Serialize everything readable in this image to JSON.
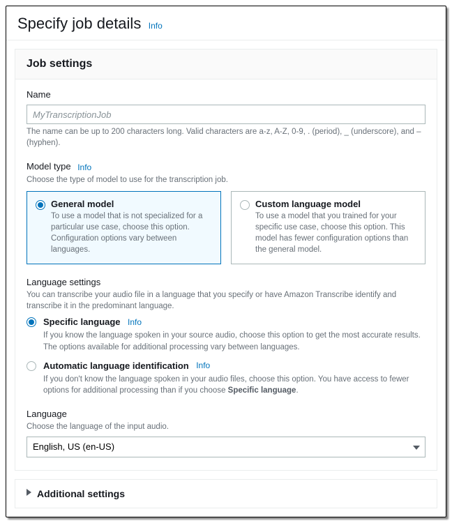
{
  "page": {
    "title": "Specify job details",
    "info": "Info"
  },
  "jobSettings": {
    "heading": "Job settings",
    "name": {
      "label": "Name",
      "placeholder": "MyTranscriptionJob",
      "hint": "The name can be up to 200 characters long. Valid characters are a-z, A-Z, 0-9, . (period), _ (underscore), and – (hyphen)."
    },
    "modelType": {
      "label": "Model type",
      "info": "Info",
      "hint": "Choose the type of model to use for the transcription job.",
      "options": [
        {
          "title": "General model",
          "desc": "To use a model that is not specialized for a particular use case, choose this option. Configuration options vary between languages.",
          "selected": true
        },
        {
          "title": "Custom language model",
          "desc": "To use a model that you trained for your specific use case, choose this option. This model has fewer configuration options than the general model.",
          "selected": false
        }
      ]
    },
    "languageSettings": {
      "label": "Language settings",
      "hint": "You can transcribe your audio file in a language that you specify or have Amazon Transcribe identify and transcribe it in the predominant language.",
      "options": [
        {
          "title": "Specific language",
          "info": "Info",
          "desc": "If you know the language spoken in your source audio, choose this option to get the most accurate results. The options available for additional processing vary between languages.",
          "selected": true
        },
        {
          "title": "Automatic language identification",
          "info": "Info",
          "desc_prefix": "If you don't know the language spoken in your audio files, choose this option. You have access to fewer options for additional processing than if you choose ",
          "desc_bold": "Specific language",
          "desc_suffix": ".",
          "selected": false
        }
      ]
    },
    "language": {
      "label": "Language",
      "hint": "Choose the language of the input audio.",
      "value": "English, US (en-US)"
    }
  },
  "additional": {
    "title": "Additional settings"
  }
}
